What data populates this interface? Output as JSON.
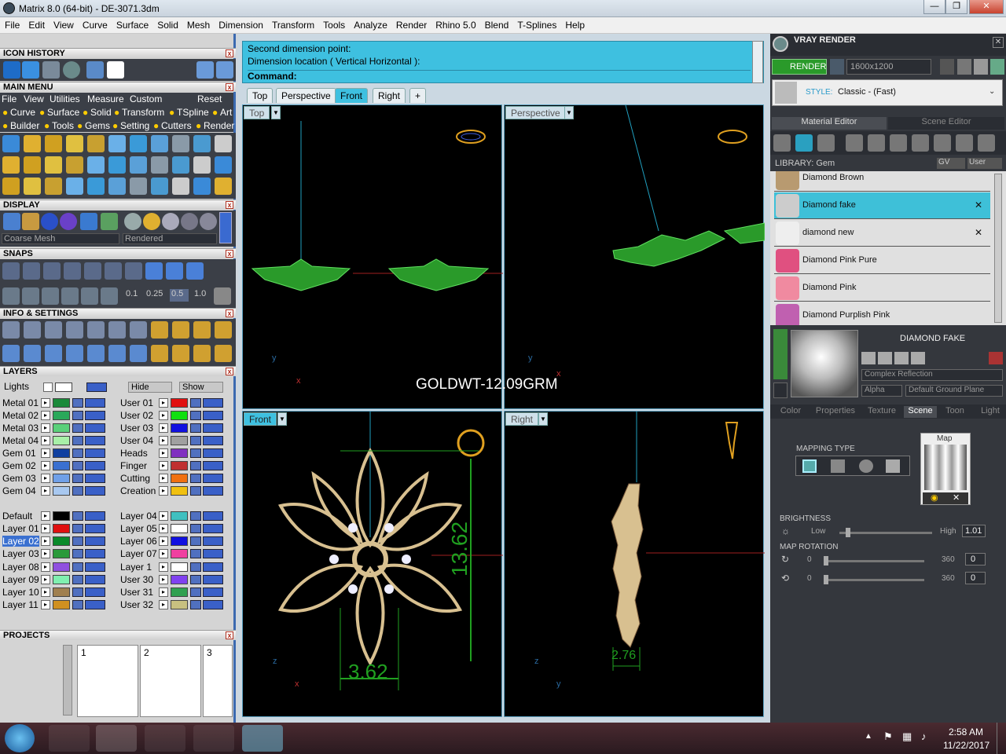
{
  "window": {
    "title": "Matrix 8.0 (64-bit) - DE-3071.3dm",
    "min": "—",
    "max": "❐",
    "close": "✕"
  },
  "menu": [
    "File",
    "Edit",
    "View",
    "Curve",
    "Surface",
    "Solid",
    "Mesh",
    "Dimension",
    "Transform",
    "Tools",
    "Analyze",
    "Render",
    "Rhino 5.0",
    "Blend",
    "T-Splines",
    "Help"
  ],
  "left": {
    "icon_history": "ICON HISTORY",
    "main_menu": "MAIN MENU",
    "main_menu_items": [
      "File",
      "View",
      "Utilities",
      "Measure",
      "Custom"
    ],
    "reset": "Reset",
    "cat_row1": [
      "Curve",
      "Surface",
      "Solid",
      "Transform",
      "TSpline",
      "Art"
    ],
    "cat_row2": [
      "Builder",
      "Tools",
      "Gems",
      "Setting",
      "Cutters",
      "Render"
    ],
    "display": "DISPLAY",
    "mesh_select": "Coarse Mesh",
    "render_select": "Rendered",
    "snaps": "SNAPS",
    "snap_values": [
      "0.1",
      "0.25",
      "0.5",
      "1.0"
    ],
    "info": "INFO & SETTINGS",
    "layers": "LAYERS",
    "lights": "Lights",
    "hide": "Hide",
    "show": "Show",
    "projects": "PROJECTS",
    "project_cols": [
      "1",
      "2",
      "3"
    ]
  },
  "layers_left": [
    {
      "name": "Metal 01",
      "color": "#1a8a3a"
    },
    {
      "name": "Metal 02",
      "color": "#2aa85a"
    },
    {
      "name": "Metal 03",
      "color": "#5ad07a"
    },
    {
      "name": "Metal 04",
      "color": "#a8f0a8"
    },
    {
      "name": "Gem 01",
      "color": "#1040a0"
    },
    {
      "name": "Gem 02",
      "color": "#3a70d0"
    },
    {
      "name": "Gem 03",
      "color": "#70a0e8"
    },
    {
      "name": "Gem 04",
      "color": "#a8c8f0"
    },
    {
      "name": "Default",
      "color": "#000000"
    },
    {
      "name": "Layer 01",
      "color": "#e01010"
    },
    {
      "name": "Layer 02",
      "color": "#0a8a2a"
    },
    {
      "name": "Layer 03",
      "color": "#2a9a3a"
    },
    {
      "name": "Layer 08",
      "color": "#9050e0"
    },
    {
      "name": "Layer 09",
      "color": "#80f0b0"
    },
    {
      "name": "Layer 10",
      "color": "#a08050"
    },
    {
      "name": "Layer 11",
      "color": "#d09020"
    }
  ],
  "layers_right": [
    {
      "name": "User 01",
      "color": "#e01010"
    },
    {
      "name": "User 02",
      "color": "#10e010"
    },
    {
      "name": "User 03",
      "color": "#1010e0"
    },
    {
      "name": "User 04",
      "color": "#a0a0a0"
    },
    {
      "name": "Heads",
      "color": "#8030c0"
    },
    {
      "name": "Finger",
      "color": "#c03030"
    },
    {
      "name": "Cutting",
      "color": "#f07010"
    },
    {
      "name": "Creation",
      "color": "#f0c010"
    },
    {
      "name": "Layer 04",
      "color": "#40c0c0"
    },
    {
      "name": "Layer 05",
      "color": "#ffffff"
    },
    {
      "name": "Layer 06",
      "color": "#1010e0"
    },
    {
      "name": "Layer 07",
      "color": "#f040a0"
    },
    {
      "name": "Layer 1",
      "color": "#ffffff"
    },
    {
      "name": "User 30",
      "color": "#8040f0"
    },
    {
      "name": "User 31",
      "color": "#30a050"
    },
    {
      "name": "User 32",
      "color": "#c8c080"
    }
  ],
  "command": {
    "line1": "Second dimension point:",
    "line2": "Dimension location ( Vertical  Horizontal ):",
    "line3": "Command:"
  },
  "tabs": [
    "Top",
    "Perspective",
    "Front",
    "Right",
    "+"
  ],
  "viewports": {
    "top": "Top",
    "perspective": "Perspective",
    "front": "Front",
    "right": "Right"
  },
  "annotations": {
    "goldwt": "GOLDWT-12.09GRM",
    "dim_height": "13.62",
    "dim_width": "3.62",
    "dim_side": "2.76"
  },
  "axes": {
    "y": "y",
    "x": "x",
    "z": "z"
  },
  "right": {
    "title": "VRAY RENDER",
    "render_btn": "RENDER",
    "resolution": "1600x1200",
    "style_label": "STYLE:",
    "style_value": "Classic - (Fast)",
    "tab_material": "Material Editor",
    "tab_scene": "Scene Editor",
    "library": "LIBRARY: Gem",
    "gv": "GV",
    "user": "User",
    "materials": [
      {
        "name": "Diamond Brown",
        "color": "#b89a70",
        "x": ""
      },
      {
        "name": "Diamond fake",
        "color": "#cccccc",
        "x": "✕"
      },
      {
        "name": "diamond new",
        "color": "#eeeeee",
        "x": "✕"
      },
      {
        "name": "Diamond Pink Pure",
        "color": "#e05080",
        "x": ""
      },
      {
        "name": "Diamond Pink",
        "color": "#f08aa0",
        "x": ""
      },
      {
        "name": "Diamond Purplish Pink",
        "color": "#c060b0",
        "x": ""
      }
    ],
    "selected": "DIAMOND FAKE",
    "reflection": "Complex Reflection",
    "alpha": "Alpha",
    "ground": "Default Ground Plane",
    "subtabs": [
      "Color",
      "Properties",
      "Texture",
      "Scene",
      "Toon",
      "Light"
    ],
    "mapping_type": "MAPPING TYPE",
    "map": "Map",
    "brightness": "BRIGHTNESS",
    "low": "Low",
    "high": "High",
    "brightness_val": "1.01",
    "map_rotation": "MAP ROTATION",
    "rot": [
      {
        "min": "0",
        "max": "360",
        "val": "0"
      },
      {
        "min": "0",
        "max": "360",
        "val": "0"
      }
    ]
  },
  "taskbar": {
    "time": "2:58 AM",
    "date": "11/22/2017"
  }
}
